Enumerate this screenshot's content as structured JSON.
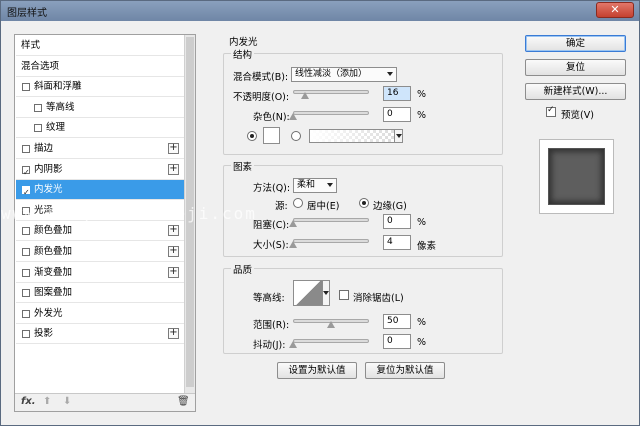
{
  "window": {
    "title": "图层样式",
    "close_label": "✕"
  },
  "left_list": {
    "items": [
      {
        "label": "样式",
        "checkbox": false,
        "checked": false,
        "plus": false,
        "selected": false,
        "indent": false
      },
      {
        "label": "混合选项",
        "checkbox": false,
        "checked": false,
        "plus": false,
        "selected": false,
        "indent": false
      },
      {
        "label": "斜面和浮雕",
        "checkbox": true,
        "checked": false,
        "plus": false,
        "selected": false,
        "indent": false
      },
      {
        "label": "等高线",
        "checkbox": true,
        "checked": false,
        "plus": false,
        "selected": false,
        "indent": true
      },
      {
        "label": "纹理",
        "checkbox": true,
        "checked": false,
        "plus": false,
        "selected": false,
        "indent": true
      },
      {
        "label": "描边",
        "checkbox": true,
        "checked": false,
        "plus": true,
        "selected": false,
        "indent": false
      },
      {
        "label": "内阴影",
        "checkbox": true,
        "checked": true,
        "plus": true,
        "selected": false,
        "indent": false
      },
      {
        "label": "内发光",
        "checkbox": true,
        "checked": true,
        "plus": false,
        "selected": true,
        "indent": false
      },
      {
        "label": "光泽",
        "checkbox": true,
        "checked": false,
        "plus": false,
        "selected": false,
        "indent": false
      },
      {
        "label": "颜色叠加",
        "checkbox": true,
        "checked": false,
        "plus": true,
        "selected": false,
        "indent": false
      },
      {
        "label": "颜色叠加",
        "checkbox": true,
        "checked": false,
        "plus": true,
        "selected": false,
        "indent": false
      },
      {
        "label": "渐变叠加",
        "checkbox": true,
        "checked": false,
        "plus": true,
        "selected": false,
        "indent": false
      },
      {
        "label": "图案叠加",
        "checkbox": true,
        "checked": false,
        "plus": false,
        "selected": false,
        "indent": false
      },
      {
        "label": "外发光",
        "checkbox": true,
        "checked": false,
        "plus": false,
        "selected": false,
        "indent": false
      },
      {
        "label": "投影",
        "checkbox": true,
        "checked": false,
        "plus": true,
        "selected": false,
        "indent": false
      }
    ],
    "footer": {
      "fx": "fx.",
      "up": "⬆",
      "down": "⬇",
      "trash": "🗑"
    }
  },
  "inner_glow": {
    "title": "内发光",
    "structure": {
      "title": "结构",
      "blend_mode_label": "混合模式(B):",
      "blend_mode_value": "线性减淡（添加）",
      "opacity_label": "不透明度(O):",
      "opacity_value": "16",
      "opacity_fraction": 0.16,
      "noise_label": "杂色(N):",
      "noise_value": "0",
      "noise_fraction": 0.0,
      "percent": "%"
    },
    "elements": {
      "title": "图素",
      "method_label": "方法(Q):",
      "method_value": "柔和",
      "source_label": "源:",
      "center_label": "居中(E)",
      "edge_label": "边缘(G)",
      "choke_label": "阻塞(C):",
      "choke_value": "0",
      "choke_fraction": 0.0,
      "size_label": "大小(S):",
      "size_value": "4",
      "size_unit": "像素",
      "percent": "%"
    },
    "quality": {
      "title": "品质",
      "contour_label": "等高线:",
      "antialias_label": "消除锯齿(L)",
      "range_label": "范围(R):",
      "range_value": "50",
      "range_fraction": 0.5,
      "jitter_label": "抖动(J):",
      "jitter_value": "0",
      "jitter_fraction": 0.0,
      "percent": "%"
    },
    "make_default": "设置为默认值",
    "reset_default": "复位为默认值"
  },
  "buttons": {
    "ok": "确定",
    "reset": "复位",
    "new_style": "新建样式(W)...",
    "preview_label": "预览(V)",
    "preview_checked": true
  },
  "watermark": "www.haoyidiansheji.com"
}
